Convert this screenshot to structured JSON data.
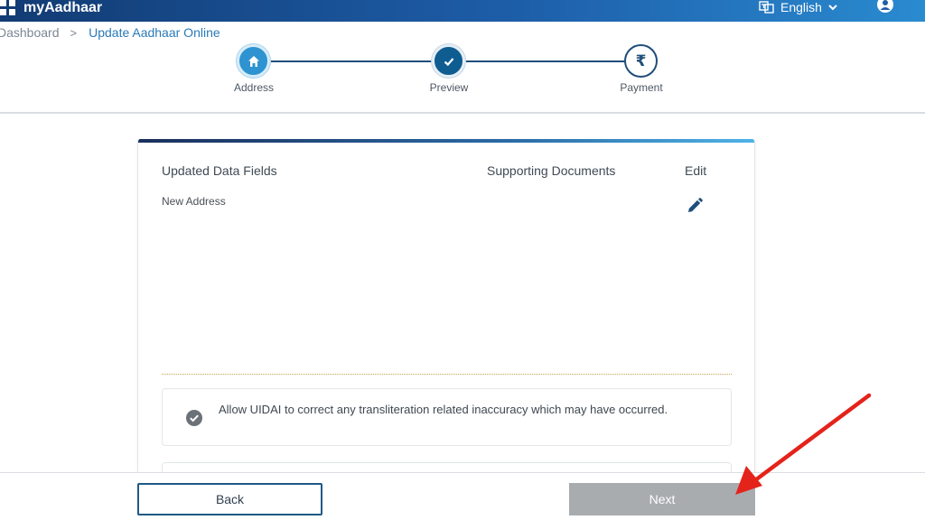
{
  "header": {
    "brand": "myAadhaar",
    "language": "English"
  },
  "breadcrumb": {
    "home": "Dashboard",
    "separator": ">",
    "current": "Update Aadhaar Online"
  },
  "stepper": {
    "steps": [
      {
        "label": "Address",
        "state": "active",
        "icon": "home-icon"
      },
      {
        "label": "Preview",
        "state": "done",
        "icon": "check-icon"
      },
      {
        "label": "Payment",
        "state": "pending",
        "icon": "rupee-icon",
        "symbol": "₹"
      }
    ]
  },
  "card": {
    "columns": {
      "updated_fields": "Updated Data Fields",
      "supporting_documents": "Supporting Documents",
      "edit": "Edit"
    },
    "rows": [
      {
        "field": "New Address",
        "document": "",
        "edit_icon": "pencil-icon"
      }
    ],
    "consent_text": "Allow UIDAI to correct any transliteration related inaccuracy which may have occurred."
  },
  "footer": {
    "back_label": "Back",
    "next_label": "Next",
    "next_disabled": true
  },
  "colors": {
    "header_start": "#123b73",
    "header_end": "#2a8bd0",
    "accent": "#2e93d0",
    "step_done": "#0f5c91",
    "next_disabled": "#a9acaf",
    "annotation_arrow": "#e4231b"
  }
}
